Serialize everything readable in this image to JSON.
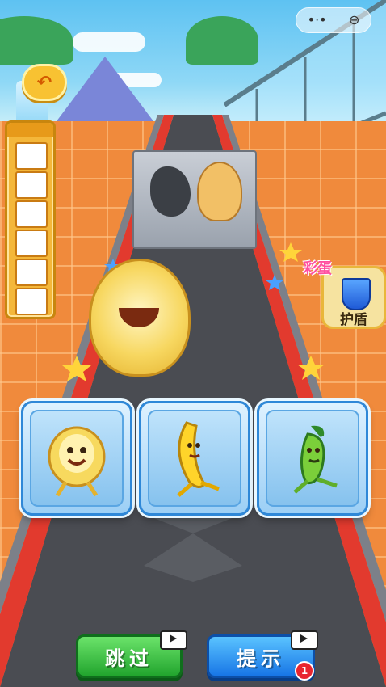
{
  "capsule": {
    "more_icon": "dots-icon",
    "close_icon": "record-icon"
  },
  "back_button": {
    "icon": "undo-arrow-icon"
  },
  "slots": {
    "count": 6
  },
  "shield": {
    "tag": "彩蛋",
    "label": "护盾"
  },
  "answers": [
    {
      "name": "cabbage"
    },
    {
      "name": "banana"
    },
    {
      "name": "pepper"
    }
  ],
  "buttons": {
    "skip_label": "跳过",
    "hint_label": "提示",
    "hint_badge": "1"
  },
  "colors": {
    "skip": "#22a52e",
    "hint": "#1876e6",
    "track": "#4a4c52",
    "rail": "#e23a2e"
  }
}
